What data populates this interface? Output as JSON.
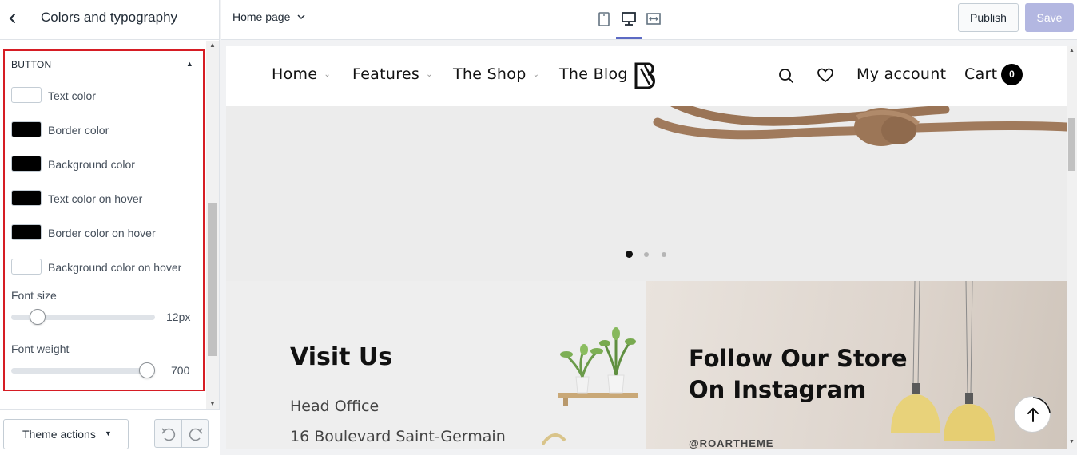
{
  "sidebar": {
    "title": "Colors and typography",
    "section": {
      "heading": "BUTTON",
      "colors": [
        {
          "label": "Text color",
          "value": "#ffffff"
        },
        {
          "label": "Border color",
          "value": "#000000"
        },
        {
          "label": "Background color",
          "value": "#000000"
        },
        {
          "label": "Text color on hover",
          "value": "#000000"
        },
        {
          "label": "Border color on hover",
          "value": "#000000"
        },
        {
          "label": "Background color on hover",
          "value": "#ffffff"
        }
      ],
      "font_size": {
        "label": "Font size",
        "value_text": "12px",
        "level": 0.1
      },
      "font_weight": {
        "label": "Font weight",
        "value_text": "700",
        "level": 1.0
      }
    },
    "footer": {
      "theme_actions": "Theme actions",
      "undo_icon": "undo-icon",
      "redo_icon": "redo-icon"
    }
  },
  "topbar": {
    "page": "Home page",
    "devices": [
      "mobile-icon",
      "desktop-icon",
      "full-width-icon"
    ],
    "active_device": "desktop-icon",
    "publish": "Publish",
    "save": "Save",
    "accent_color": "#5c6ac4"
  },
  "preview": {
    "nav": {
      "items": [
        {
          "label": "Home",
          "has_caret": true
        },
        {
          "label": "Features",
          "has_caret": true
        },
        {
          "label": "The Shop",
          "has_caret": true
        },
        {
          "label": "The Blog",
          "has_caret": false
        }
      ],
      "account": "My account",
      "cart": "Cart",
      "cart_count": "0"
    },
    "hero": {
      "slides": 3,
      "active_slide": 1
    },
    "visit": {
      "title": "Visit Us",
      "office": "Head Office",
      "address": "16 Boulevard Saint-Germain"
    },
    "instagram": {
      "title": "Follow Our Store On Instagram",
      "handle": "@ROARTHEME"
    }
  }
}
